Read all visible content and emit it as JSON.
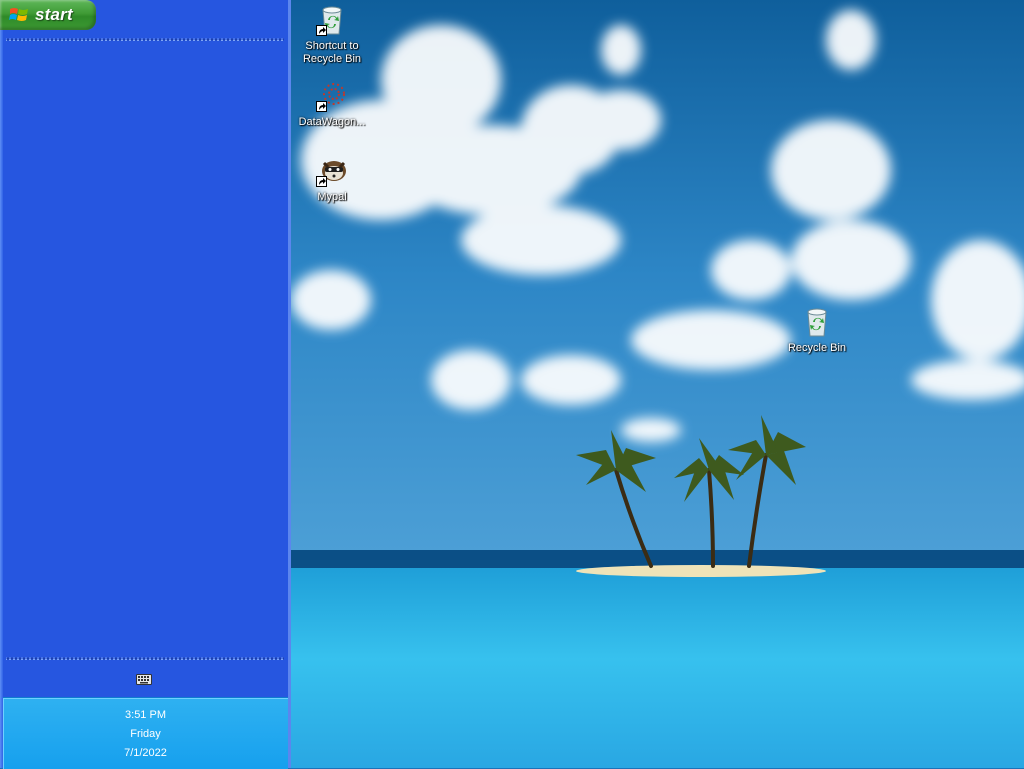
{
  "taskbar": {
    "start_label": "start",
    "tray_icons": [
      "keyboard-icon"
    ],
    "clock": {
      "time": "3:51 PM",
      "day": "Friday",
      "date": "7/1/2022"
    }
  },
  "desktop": {
    "icons": [
      {
        "label": "Shortcut to\nRecycle Bin",
        "icon": "recycle-bin-icon",
        "shortcut": true
      },
      {
        "label": "DataWagon...",
        "icon": "datawagon-icon",
        "shortcut": true
      },
      {
        "label": "Mypal",
        "icon": "mypal-icon",
        "shortcut": true
      },
      {
        "label": "Recycle Bin",
        "icon": "recycle-bin-icon",
        "shortcut": false
      }
    ]
  },
  "colors": {
    "taskbar_blue": "#2656e0",
    "start_green": "#3f9b35",
    "clock_area": "#16a0ee"
  }
}
